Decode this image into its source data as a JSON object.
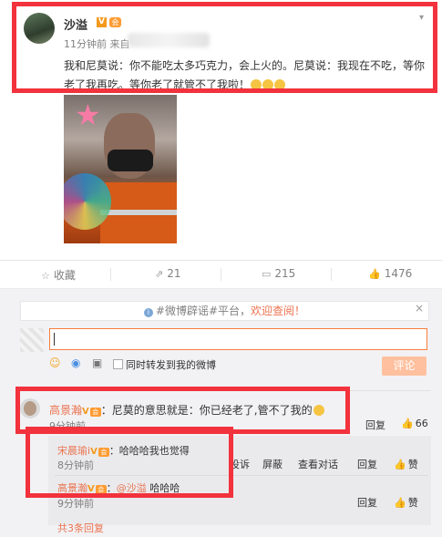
{
  "post": {
    "username": "沙溢",
    "verified_badge": "V",
    "member_badge": "会",
    "time": "11分钟前 来自",
    "text": "我和尼莫说：你不能吃太多巧克力，会上火的。尼莫说：我现在不吃，等你老了我再吃。等你老了就管不了我啦！",
    "emoji_count_label": "😂😂😂"
  },
  "actions": {
    "favorite": "收藏",
    "repost": "21",
    "comment": "215",
    "like": "1476"
  },
  "notice": {
    "prefix": "#微博辟谣#平台，",
    "highlight": "欢迎查阅！",
    "close": "×"
  },
  "composer": {
    "repost_label": "同时转发到我的微博",
    "submit_label": "评论"
  },
  "comments": [
    {
      "user": "高景瀚",
      "text": "：尼莫的意思就是：你已经老了,管不了我的",
      "time": "9分钟前",
      "reply_label": "回复",
      "likes": "66"
    }
  ],
  "replies": [
    {
      "user": "宋晨瑜i",
      "text": "：哈哈哈我也觉得",
      "time": "8分钟前",
      "ops": [
        "投诉",
        "屏蔽",
        "查看对话",
        "回复"
      ],
      "like_label": "赞"
    },
    {
      "user": "高景瀚",
      "mention": "@沙溢",
      "text": " 哈哈哈",
      "time": "9分钟前",
      "reply_label": "回复",
      "like_label": "赞"
    }
  ],
  "more_replies": "共3条回复",
  "colors": {
    "accent": "#eb7350",
    "highlight_box": "#f2323c",
    "submit_disabled": "#ffc09f"
  }
}
